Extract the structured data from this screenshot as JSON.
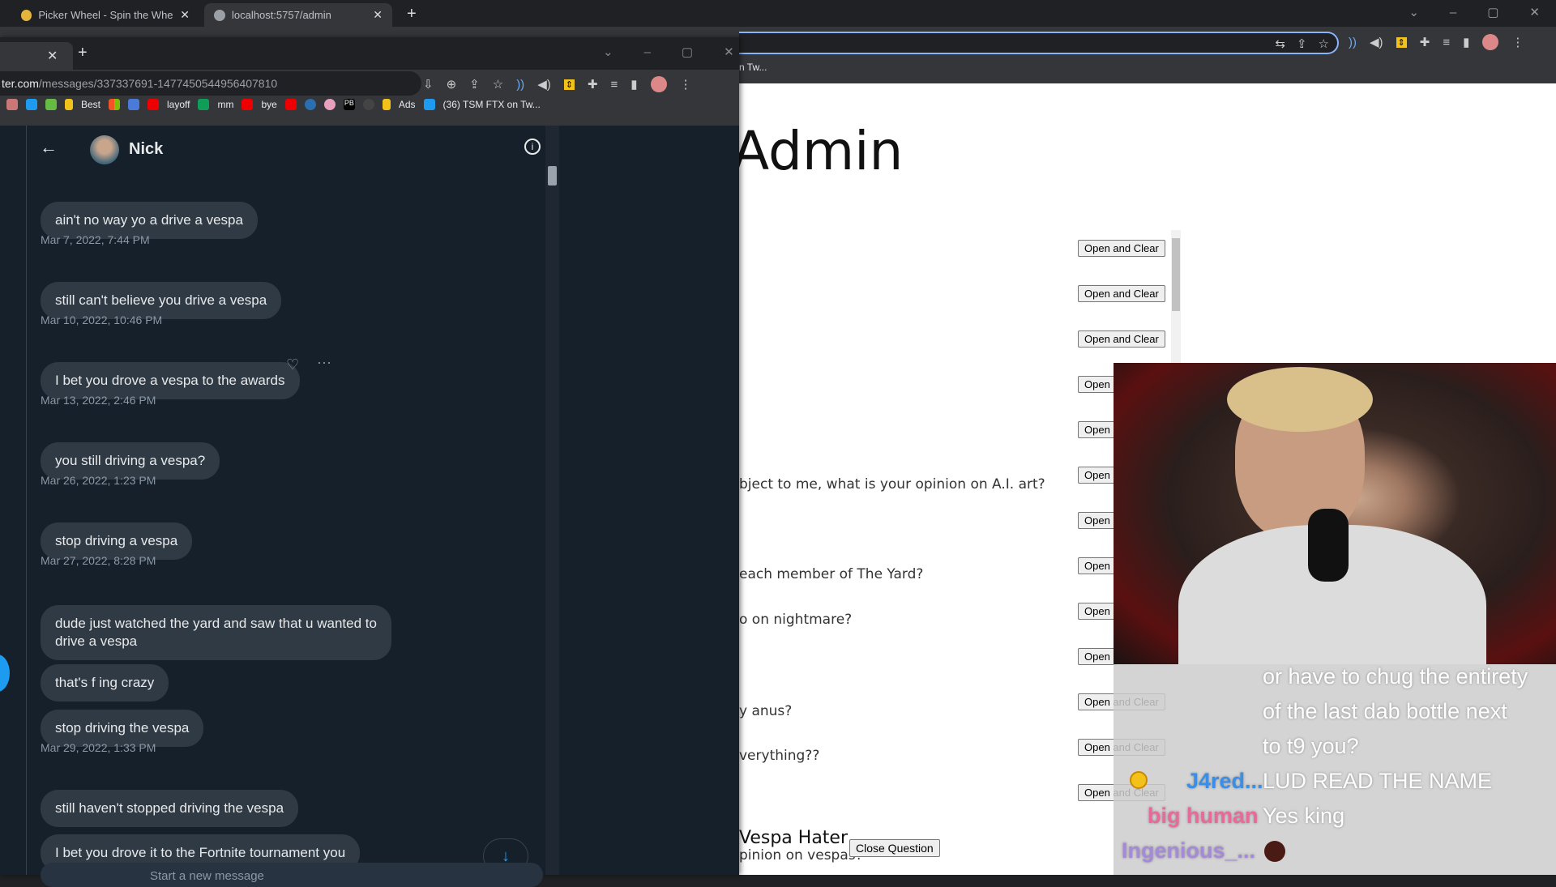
{
  "outer_browser": {
    "tabs": [
      {
        "title": "Picker Wheel - Spin the Wheel to",
        "icon": "picker-wheel-icon"
      },
      {
        "title": "localhost:5757/admin",
        "icon": "globe-icon",
        "active": true
      }
    ],
    "bookmark_partial": "n Tw..."
  },
  "inner_browser": {
    "url_host": "ter.com",
    "url_path": "/messages/337337691-1477450544956407810",
    "bookmarks": [
      "Best",
      "layoff",
      "mm",
      "bye",
      "PB",
      "Ads",
      "(36) TSM FTX on Tw..."
    ]
  },
  "dm": {
    "contact_name": "Nick",
    "messages": [
      {
        "text": "ain't no way yo a     drive a vespa",
        "time": "Mar 7, 2022, 7:44 PM"
      },
      {
        "text": "still can't believe you drive a vespa",
        "time": "Mar 10, 2022, 10:46 PM"
      },
      {
        "text": "I bet you drove a vespa to the awards",
        "time": "Mar 13, 2022, 2:46 PM"
      },
      {
        "text": "you still driving a vespa?",
        "time": "Mar 26, 2022, 1:23 PM"
      },
      {
        "text": "stop driving a vespa",
        "time": "Mar 27, 2022, 8:28 PM"
      },
      {
        "text": "dude just watched the yard and saw that u wanted to drive a vespa"
      },
      {
        "text": "that's f      ing crazy"
      },
      {
        "text": "stop driving the vespa",
        "time": "Mar 29, 2022, 1:33 PM"
      },
      {
        "text": "still haven't stopped driving the vespa"
      },
      {
        "text": "I bet you drove it to the Fortnite tournament you"
      }
    ],
    "input_placeholder": "Start a new message"
  },
  "admin": {
    "title": "Admin",
    "button_label": "Open and Clear",
    "button_label_partial": "Open",
    "questions": [
      "bject to me, what is your opinion on A.I. art?",
      "each member of The Yard?",
      "o on nightmare?",
      "y anus?",
      "verything??"
    ],
    "current_user": "Vespa Hater",
    "current_question": "pinion on vespas?",
    "close_label": "Close Question"
  },
  "stream_chat": [
    {
      "user": "",
      "text": "or have to chug the entirety"
    },
    {
      "user": "",
      "text": "of the last dab bottle next"
    },
    {
      "user": "",
      "text": "to t9 you?"
    },
    {
      "user": "J4red...",
      "color": "#3a8ee6",
      "text": "LUD READ THE NAME"
    },
    {
      "user": "big human",
      "color": "#e86a9a",
      "text": "Yes king"
    },
    {
      "user": "Ingenious_...",
      "color": "#a48ad8",
      "text": ""
    }
  ],
  "colors": {
    "twitter_bg": "#15202b",
    "bubble": "#2f3a45",
    "accent": "#1d9bf0"
  }
}
